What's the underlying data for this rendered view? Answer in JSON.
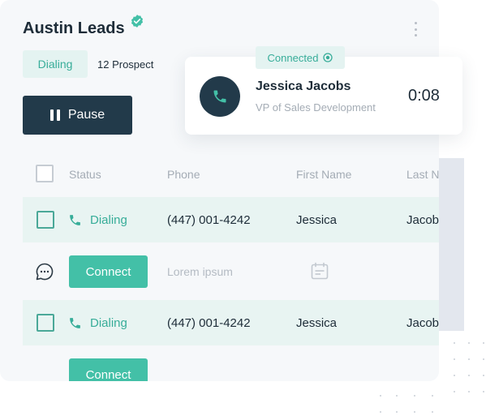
{
  "header": {
    "title": "Austin Leads",
    "status_badge": "Dialing",
    "prospect_count": "12 Prospect",
    "pause_label": "Pause"
  },
  "icons": {
    "verified": "verified-check-icon",
    "menu": "kebab-menu-icon",
    "pause": "pause-icon",
    "phone": "phone-icon",
    "chat": "chat-bubble-icon",
    "calendar": "calendar-icon",
    "connected": "target-icon"
  },
  "table": {
    "columns": [
      "Status",
      "Phone",
      "First Name",
      "Last N"
    ],
    "rows": [
      {
        "status": "Dialing",
        "phone": "(447) 001-4242",
        "first_name": "Jessica",
        "last_name": "Jacob"
      },
      {
        "status": "Dialing",
        "phone": "(447) 001-4242",
        "first_name": "Jessica",
        "last_name": "Jacob"
      }
    ],
    "connect_label": "Connect",
    "note_placeholder": "Lorem ipsum"
  },
  "call": {
    "status": "Connected",
    "name": "Jessica Jacobs",
    "title": "VP of Sales Development",
    "timer": "0:08"
  },
  "colors": {
    "accent": "#43c0a7",
    "accent_text": "#37ad99",
    "dark": "#223a4a",
    "row_highlight": "#e8f4f2"
  }
}
